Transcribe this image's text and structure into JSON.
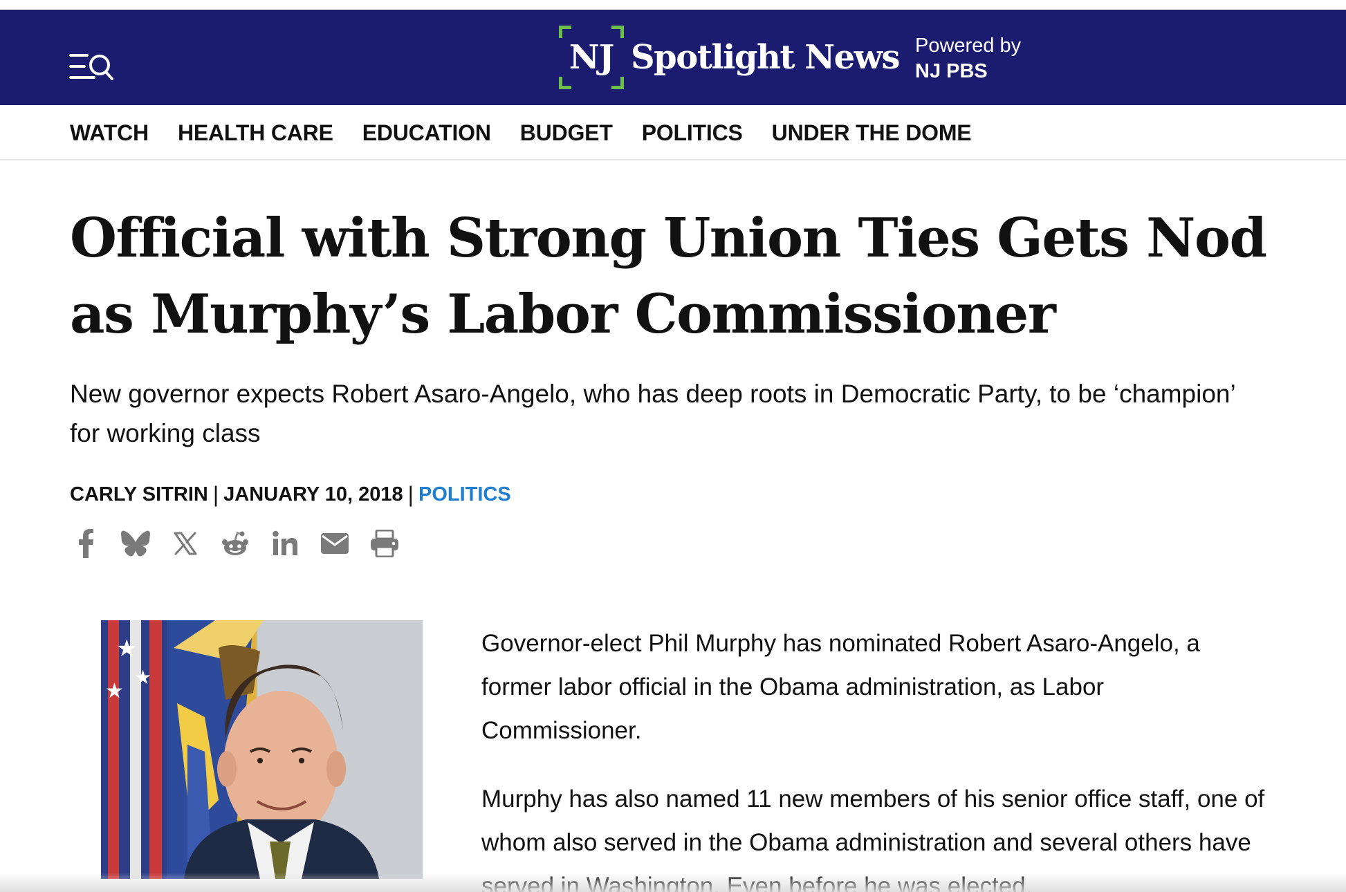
{
  "header": {
    "logo_mark": "NJ",
    "logo_name": "Spotlight News",
    "powered_by": "Powered by",
    "powered_org": "NJ PBS",
    "menu_icon": "menu-search-icon",
    "colors": {
      "header_bg": "#1b1c70",
      "logo_accent": "#6cc04a"
    }
  },
  "nav": {
    "items": [
      {
        "label": "WATCH"
      },
      {
        "label": "HEALTH CARE"
      },
      {
        "label": "EDUCATION"
      },
      {
        "label": "BUDGET"
      },
      {
        "label": "POLITICS"
      },
      {
        "label": "UNDER THE DOME"
      }
    ]
  },
  "article": {
    "headline": "Official with Strong Union Ties Gets Nod as Murphy’s Labor Commissioner",
    "subhead": "New governor expects Robert Asaro-Angelo, who has deep roots in Democratic Party, to be ‘champion’ for working class",
    "byline": {
      "author": "CARLY SITRIN",
      "separator": "|",
      "date": "JANUARY 10, 2018",
      "category": "POLITICS",
      "category_color": "#1f7ed0"
    },
    "share": [
      {
        "icon": "facebook-icon"
      },
      {
        "icon": "bluesky-icon"
      },
      {
        "icon": "x-icon"
      },
      {
        "icon": "reddit-icon"
      },
      {
        "icon": "linkedin-icon"
      },
      {
        "icon": "email-icon"
      },
      {
        "icon": "print-icon"
      }
    ],
    "body": [
      "Governor-elect Phil Murphy has nominated Robert Asaro-Angelo, a former labor official in the Obama administration, as Labor Commissioner.",
      "Murphy has also named 11 new members of his senior office staff, one of whom also served in the Obama administration and several others have served in Washington. Even before he was elected,"
    ]
  }
}
